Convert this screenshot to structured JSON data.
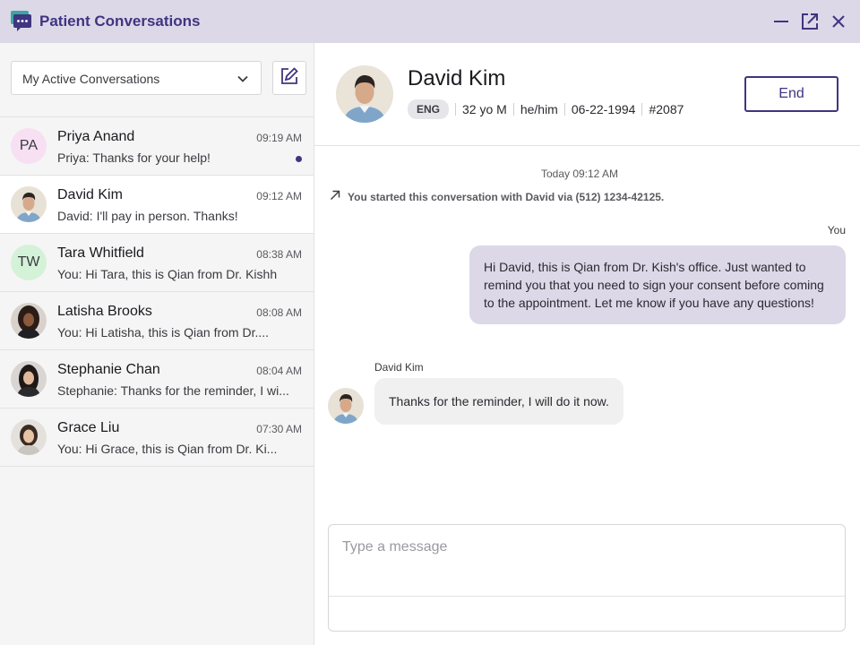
{
  "app": {
    "title": "Patient Conversations",
    "icons": {
      "logo": "chat-bubbles-icon",
      "minimize": "minimize-icon",
      "popout": "external-link-icon",
      "close": "close-icon"
    }
  },
  "sidebar": {
    "filter": {
      "selected": "My Active Conversations",
      "icon": "chevron-down-icon"
    },
    "compose_icon": "edit-icon",
    "conversations": [
      {
        "name": "Priya Anand",
        "initials": "PA",
        "time": "09:19 AM",
        "preview": "Priya: Thanks for your help!",
        "unread": true
      },
      {
        "name": "David Kim",
        "time": "09:12 AM",
        "preview": "David: I'll pay in person. Thanks!",
        "active": true
      },
      {
        "name": "Tara Whitfield",
        "initials": "TW",
        "time": "08:38 AM",
        "preview": "You: Hi Tara, this is Qian from Dr. Kishh"
      },
      {
        "name": "Latisha Brooks",
        "time": "08:08 AM",
        "preview": "You: Hi Latisha, this is Qian from Dr...."
      },
      {
        "name": "Stephanie Chan",
        "time": "08:04 AM",
        "preview": "Stephanie: Thanks for the reminder, I wi..."
      },
      {
        "name": "Grace Liu",
        "time": "07:30 AM",
        "preview": "You: Hi Grace, this is Qian from Dr. Ki..."
      }
    ]
  },
  "patient": {
    "name": "David Kim",
    "language": "ENG",
    "age_sex": "32 yo M",
    "pronouns": "he/him",
    "dob": "06-22-1994",
    "id": "#2087",
    "end_label": "End"
  },
  "thread": {
    "day_stamp": "Today 09:12 AM",
    "system_note": "You started this conversation with David via (512) 1234-42125.",
    "system_icon": "arrow-up-right-icon",
    "outgoing_sender": "You",
    "outgoing_text": "Hi David, this is Qian from Dr. Kish's office. Just wanted to remind you that you need to sign your consent before coming to the appointment. Let me know if you have any questions!",
    "incoming_sender": "David Kim",
    "incoming_text": "Thanks for the reminder, I will do it now."
  },
  "composer": {
    "placeholder": "Type a message",
    "value": ""
  },
  "colors": {
    "accent": "#3f3580",
    "titlebar": "#dcd8e8",
    "outgoing_bubble": "#dcd8e8",
    "incoming_bubble": "#f0f0f0",
    "sidebar_bg": "#f5f5f5"
  }
}
